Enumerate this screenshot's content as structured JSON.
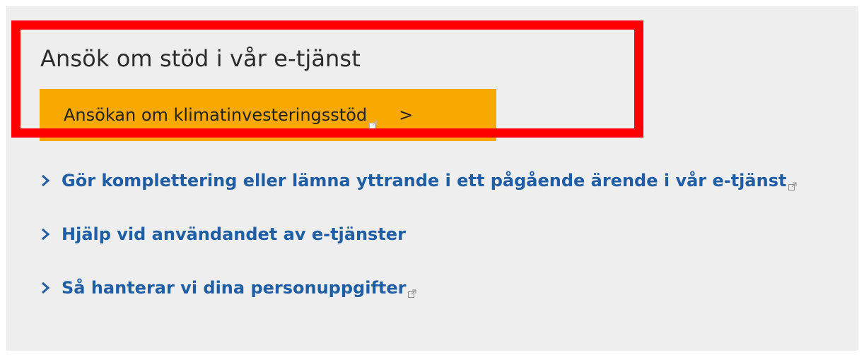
{
  "section": {
    "heading": "Ansök om stöd i vår e-tjänst",
    "apply_button_label": "Ansökan om klimatinvesteringsstöd",
    "apply_button_chevron": ">"
  },
  "links": [
    {
      "label": "Gör komplettering eller lämna yttrande i ett pågående ärende i vår e-tjänst",
      "external": true
    },
    {
      "label": "Hjälp vid användandet av e-tjänster",
      "external": false
    },
    {
      "label": "Så hanterar vi dina personuppgifter",
      "external": true
    }
  ],
  "colors": {
    "panel_background": "#eeeeee",
    "button_background": "#f9a800",
    "link_color": "#1f5da4",
    "highlight_border": "#ff0000"
  },
  "icons": {
    "external": "external-link-icon",
    "chevron": "chevron-right-icon"
  }
}
